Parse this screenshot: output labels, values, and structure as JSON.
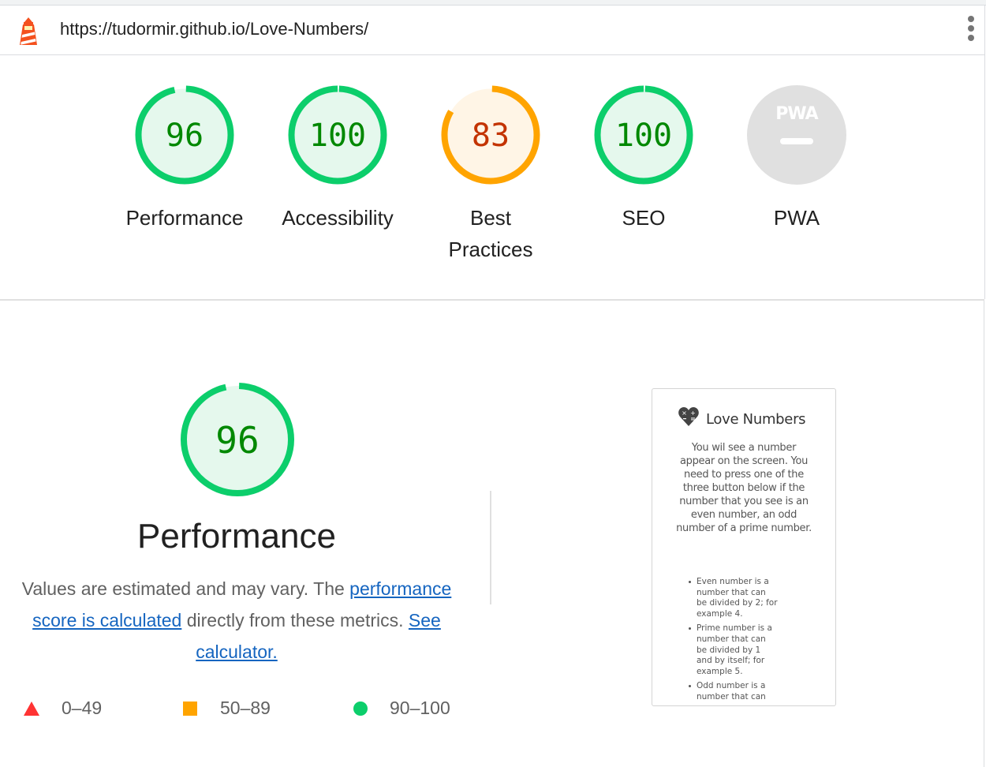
{
  "header": {
    "url": "https://tudormir.github.io/Love-Numbers/",
    "logo_icon": "lighthouse-icon",
    "menu_icon": "more-vert-icon"
  },
  "gauges": [
    {
      "label": "Performance",
      "score": "96",
      "fraction": 0.96,
      "status": "pass"
    },
    {
      "label": "Accessibility",
      "score": "100",
      "fraction": 1.0,
      "status": "pass"
    },
    {
      "label_lines": [
        "Best",
        "Practices"
      ],
      "score": "83",
      "fraction": 0.83,
      "status": "average"
    },
    {
      "label": "SEO",
      "score": "100",
      "fraction": 1.0,
      "status": "pass"
    },
    {
      "label": "PWA",
      "badge_text": "PWA",
      "status": "na"
    }
  ],
  "category": {
    "score": "96",
    "fraction": 0.96,
    "title": "Performance",
    "desc_before": "Values are estimated and may vary. The ",
    "desc_link": "performance score is calculated",
    "desc_after": " directly from these metrics. ",
    "calc_link": "See calculator."
  },
  "legend": [
    {
      "range": "0–49",
      "icon": "triangle-fail-icon"
    },
    {
      "range": "50–89",
      "icon": "square-average-icon"
    },
    {
      "range": "90–100",
      "icon": "circle-pass-icon"
    }
  ],
  "screenshot": {
    "icon": "heart-math-icon",
    "title": "Love Numbers",
    "paragraph": "You wil see a number appear on the screen. You need to press one of the three button below if the number that you see is an even number, an odd number of a prime number.",
    "list": [
      "Even number is a number that can be divided by 2; for example 4.",
      "Prime number is a number that can be divided by 1 and by itself; for example 5.",
      "Odd number is a number that can"
    ]
  },
  "colors": {
    "pass": "#0cce6b",
    "pass_text": "#008800",
    "pass_fill": "#e5f8ed",
    "average": "#ffa400",
    "average_text": "#c33300",
    "average_fill": "#fff5e6",
    "fail": "#ff3333",
    "link": "#1565c0",
    "na_fill": "#e0e0e0"
  }
}
